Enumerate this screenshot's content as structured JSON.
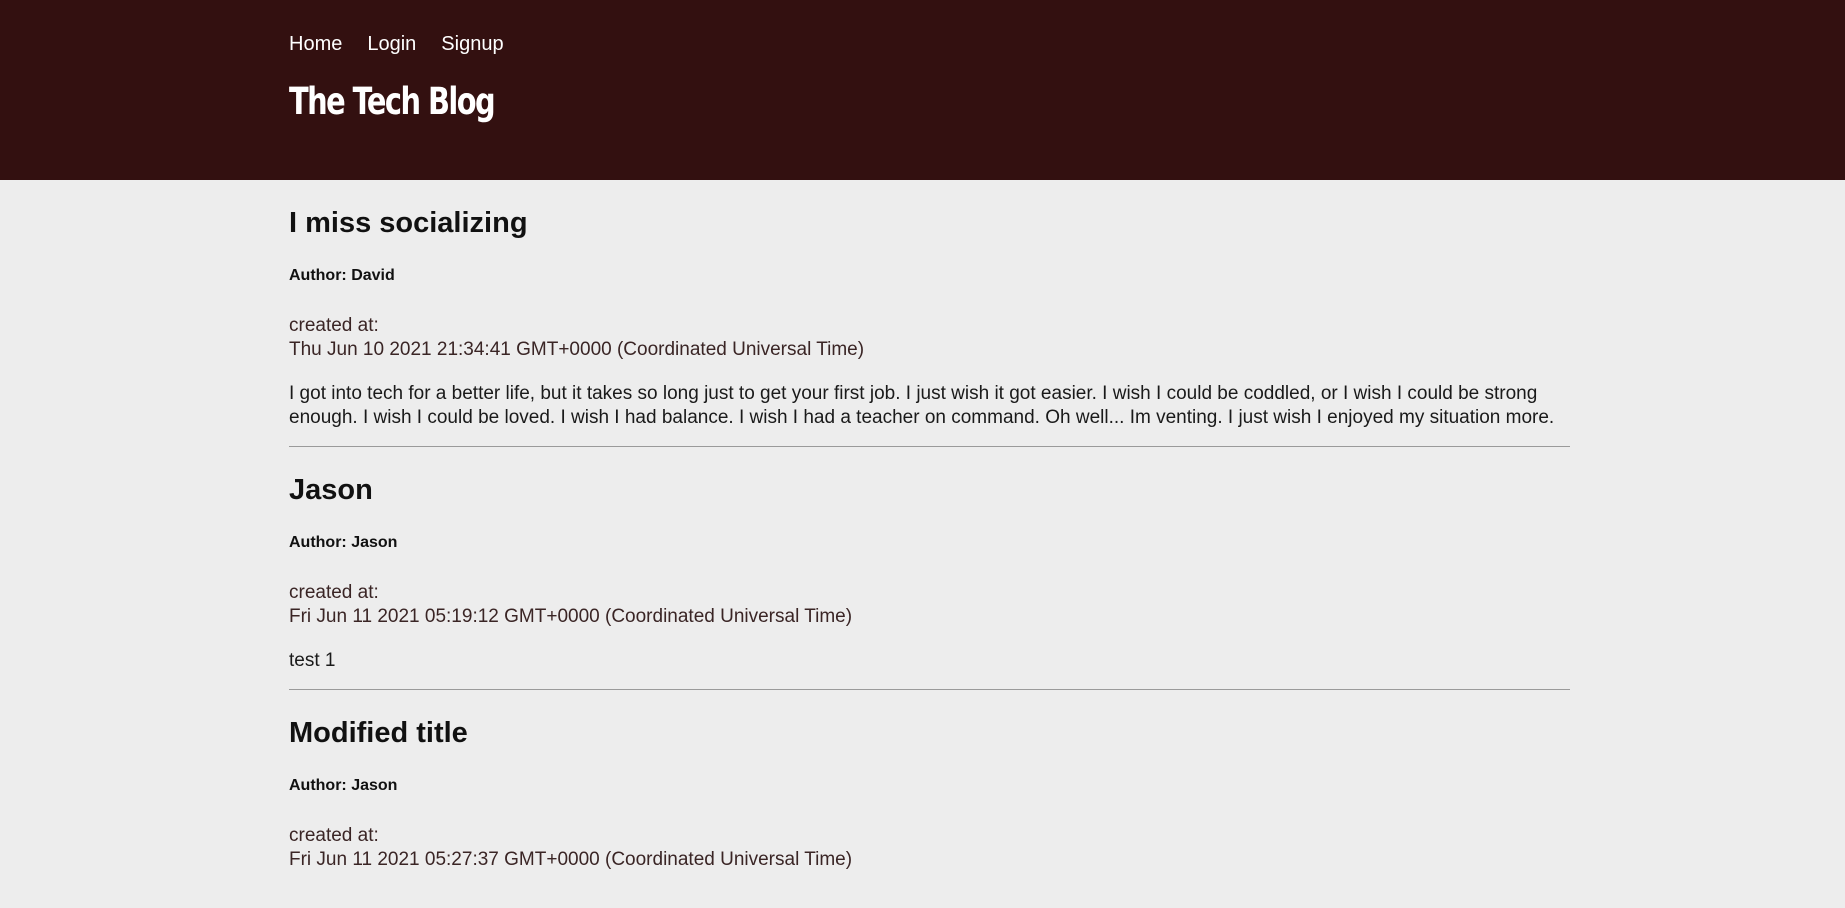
{
  "nav": {
    "home": "Home",
    "login": "Login",
    "signup": "Signup"
  },
  "site_title": "The Tech Blog",
  "posts": [
    {
      "title": "I miss socializing",
      "author": "Author: David",
      "created_label": "created at:",
      "created_at": "Thu Jun 10 2021 21:34:41 GMT+0000 (Coordinated Universal Time)",
      "body": "I got into tech for a better life, but it takes so long just to get your first job. I just wish it got easier. I wish I could be coddled, or I wish I could be strong enough. I wish I could be loved. I wish I had balance. I wish I had a teacher on command. Oh well... Im venting. I just wish I enjoyed my situation more."
    },
    {
      "title": "Jason",
      "author": "Author: Jason",
      "created_label": "created at:",
      "created_at": "Fri Jun 11 2021 05:19:12 GMT+0000 (Coordinated Universal Time)",
      "body": "test 1"
    },
    {
      "title": "Modified title",
      "author": "Author: Jason",
      "created_label": "created at:",
      "created_at": "Fri Jun 11 2021 05:27:37 GMT+0000 (Coordinated Universal Time)",
      "body": ""
    }
  ]
}
